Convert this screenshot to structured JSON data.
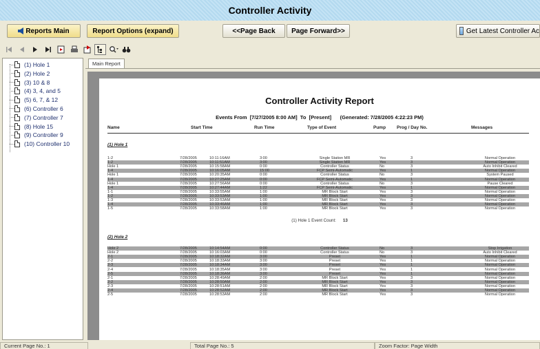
{
  "window": {
    "title": "Controller Activity"
  },
  "actions": {
    "reports_main": "Reports Main",
    "report_options": "Report Options (expand)",
    "page_back": "<<Page Back",
    "page_forward": "Page Forward>>",
    "get_latest": "Get Latest Controller Ac"
  },
  "tree": {
    "items": [
      "(1) Hole 1",
      "(2) Hole 2",
      "(3) 10 & 8",
      "(4) 3, 4, and 5",
      "(5) 6, 7, & 12",
      "(6) Controller 6",
      "(7) Controller 7",
      "(8) Hole 15",
      "(9) Controller 9",
      "(10) Controller 10"
    ]
  },
  "viewer": {
    "tab": "Main Report"
  },
  "report": {
    "title": "Controller Activity Report",
    "events_from_label": "Events From",
    "from": "[7/27/2005 8:00 AM]",
    "to_label": "To",
    "to": "[Present]",
    "generated": "(Generated: 7/28/2005 4:22:23 PM)",
    "columns": {
      "name": "Name",
      "start": "Start Time",
      "run": "Run Time",
      "type": "Type of Event",
      "pump": "Pump",
      "prog": "Prog / Day No.",
      "messages": "Messages"
    },
    "groups": [
      {
        "title": "(1) Hole 1",
        "count_label": "(1) Hole 1 Event Count:",
        "count": "13",
        "rows": [
          {
            "name": "1-2",
            "date": "7/28/2005",
            "time": "10:11:16AM",
            "run": "3:00",
            "type": "Single Station MR",
            "pump": "Yes",
            "prog": "3",
            "msg": "Normal Operation",
            "alt": false
          },
          {
            "name": "1-2",
            "date": "7/28/2005",
            "time": "10:11:51AM",
            "run": "3:00",
            "type": "Single Station MR",
            "pump": "Yes",
            "prog": "3",
            "msg": "Normal Operation",
            "alt": true
          },
          {
            "name": "Hole 1",
            "date": "7/28/2005",
            "time": "10:15:58AM",
            "run": "0:00",
            "type": "Controller Status",
            "pump": "No",
            "prog": "3",
            "msg": "Auto Inhibit Cleared",
            "alt": false
          },
          {
            "name": "1-4",
            "date": "7/28/2005",
            "time": "10:16:05AM",
            "run": "15:00",
            "type": "FCP Semi-Automatic",
            "pump": "Yes",
            "prog": "1",
            "msg": "Normal Operation",
            "alt": true
          },
          {
            "name": "Hole 1",
            "date": "7/28/2005",
            "time": "10:20:35AM",
            "run": "0:00",
            "type": "Controller Status",
            "pump": "No",
            "prog": "3",
            "msg": "System Paused",
            "alt": false
          },
          {
            "name": "1-4",
            "date": "7/28/2005",
            "time": "10:27:25AM",
            "run": "0:00",
            "type": "FCP Semi-Automatic",
            "pump": "Yes",
            "prog": "1",
            "msg": "Normal Operation",
            "alt": true
          },
          {
            "name": "Hole 1",
            "date": "7/28/2005",
            "time": "10:27:56AM",
            "run": "0:00",
            "type": "Controller Status",
            "pump": "No",
            "prog": "3",
            "msg": "Pause Cleared",
            "alt": false
          },
          {
            "name": "1-4",
            "date": "7/28/2005",
            "time": "10:27:44AM",
            "run": "1:22",
            "type": "FCP Semi-Automatic",
            "pump": "Yes",
            "prog": "1",
            "msg": "Normal Operation",
            "alt": true
          },
          {
            "name": "1-1",
            "date": "7/28/2005",
            "time": "10:33:55AM",
            "run": "1:00",
            "type": "MR Block Start",
            "pump": "Yes",
            "prog": "3",
            "msg": "Normal Operation",
            "alt": false
          },
          {
            "name": "1-2",
            "date": "7/28/2005",
            "time": "10:33:53AM",
            "run": "1:00",
            "type": "MR Block Start",
            "pump": "Yes",
            "prog": "3",
            "msg": "Normal Operation",
            "alt": true
          },
          {
            "name": "1-3",
            "date": "7/28/2005",
            "time": "10:33:53AM",
            "run": "1:00",
            "type": "MR Block Start",
            "pump": "Yes",
            "prog": "3",
            "msg": "Normal Operation",
            "alt": false
          },
          {
            "name": "1-4",
            "date": "7/28/2005",
            "time": "10:33:46AM",
            "run": "1:00",
            "type": "MR Block Start",
            "pump": "Yes",
            "prog": "3",
            "msg": "Normal Operation",
            "alt": true
          },
          {
            "name": "1-5",
            "date": "7/28/2005",
            "time": "10:33:58AM",
            "run": "1:00",
            "type": "MR Block Start",
            "pump": "Yes",
            "prog": "3",
            "msg": "Normal Operation",
            "alt": false
          }
        ]
      },
      {
        "title": "(2) Hole 2",
        "rows": [
          {
            "name": "Hole 2",
            "date": "7/28/2005",
            "time": "10:14:54AM",
            "run": "0:00",
            "type": "Controller Status",
            "pump": "No",
            "prog": "3",
            "msg": "Stop Irrigation",
            "alt": true
          },
          {
            "name": "Hole 2",
            "date": "7/28/2005",
            "time": "10:16:03AM",
            "run": "0:00",
            "type": "Controller Status",
            "pump": "No",
            "prog": "3",
            "msg": "Auto Inhibit Cleared",
            "alt": false
          },
          {
            "name": "2-1",
            "date": "7/28/2005",
            "time": "10:18:32AM",
            "run": "3:00",
            "type": "Preset",
            "pump": "Yes",
            "prog": "1",
            "msg": "Normal Operation",
            "alt": true
          },
          {
            "name": "2-2",
            "date": "7/28/2005",
            "time": "10:18:33AM",
            "run": "3:00",
            "type": "Preset",
            "pump": "Yes",
            "prog": "1",
            "msg": "Normal Operation",
            "alt": false
          },
          {
            "name": "2-3",
            "date": "7/28/2005",
            "time": "10:18:34AM",
            "run": "3:00",
            "type": "Preset",
            "pump": "Yes",
            "prog": "1",
            "msg": "Normal Operation",
            "alt": true
          },
          {
            "name": "2-4",
            "date": "7/28/2005",
            "time": "10:18:35AM",
            "run": "3:00",
            "type": "Preset",
            "pump": "Yes",
            "prog": "1",
            "msg": "Normal Operation",
            "alt": false
          },
          {
            "name": "2-5",
            "date": "7/28/2005",
            "time": "10:18:36AM",
            "run": "3:00",
            "type": "Preset",
            "pump": "Yes",
            "prog": "1",
            "msg": "Normal Operation",
            "alt": true
          },
          {
            "name": "2-1",
            "date": "7/28/2005",
            "time": "10:28:49AM",
            "run": "2:00",
            "type": "MR Block Start",
            "pump": "Yes",
            "prog": "3",
            "msg": "Normal Operation",
            "alt": false
          },
          {
            "name": "2-2",
            "date": "7/28/2005",
            "time": "10:28:50AM",
            "run": "2:00",
            "type": "MR Block Start",
            "pump": "Yes",
            "prog": "3",
            "msg": "Normal Operation",
            "alt": true
          },
          {
            "name": "2-3",
            "date": "7/28/2005",
            "time": "10:28:51AM",
            "run": "2:00",
            "type": "MR Block Start",
            "pump": "Yes",
            "prog": "3",
            "msg": "Normal Operation",
            "alt": false
          },
          {
            "name": "2-4",
            "date": "7/28/2005",
            "time": "10:28:52AM",
            "run": "2:00",
            "type": "MR Block Start",
            "pump": "Yes",
            "prog": "3",
            "msg": "Normal Operation",
            "alt": true
          },
          {
            "name": "2-5",
            "date": "7/28/2005",
            "time": "10:28:53AM",
            "run": "2:00",
            "type": "MR Block Start",
            "pump": "Yes",
            "prog": "3",
            "msg": "Normal Operation",
            "alt": false
          }
        ]
      }
    ]
  },
  "status": {
    "current_page": "Current Page No.: 1",
    "total_page": "Total Page No.: 5",
    "zoom": "Zoom Factor: Page Width"
  },
  "colors": {
    "title_bar": "#c4e3f5",
    "button": "#f0dd8a",
    "row_shade": "#a6a6a6",
    "canvas": "#8c8c8c"
  }
}
